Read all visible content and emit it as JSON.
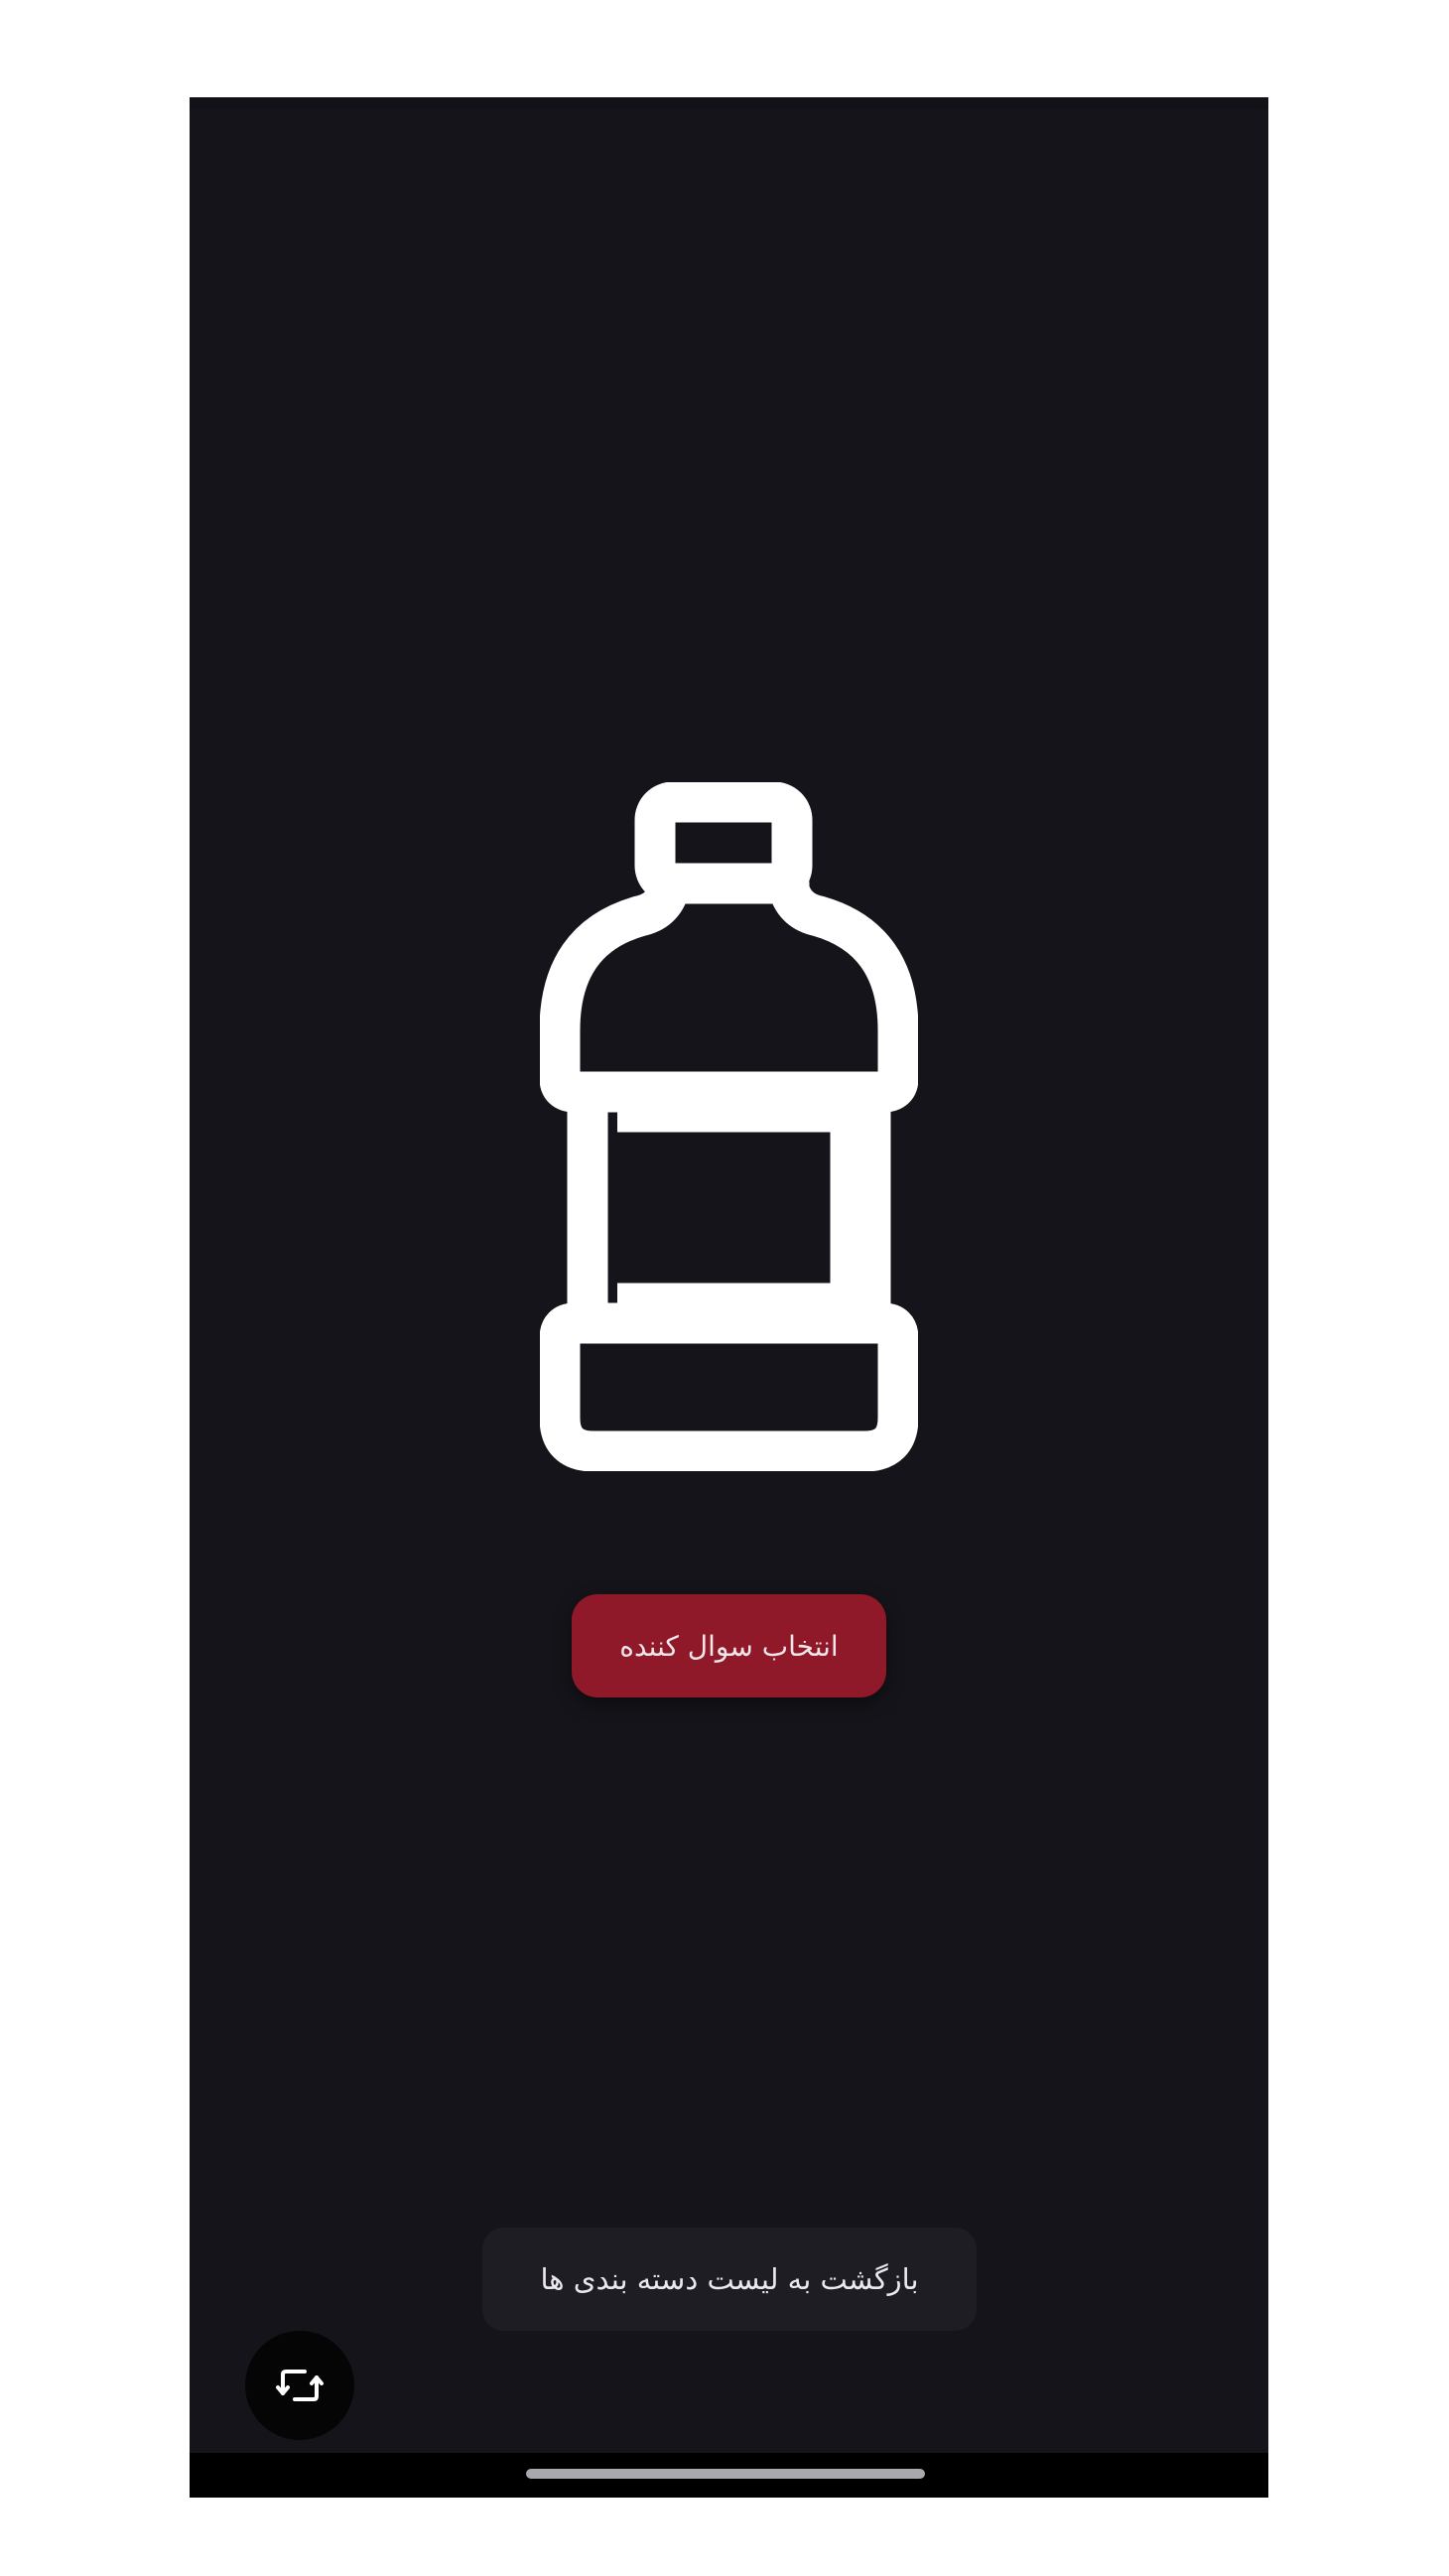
{
  "theme": {
    "background": "#15141a",
    "accent": "#8f1829",
    "icon_color": "#ffffff",
    "secondary_button": "#1e1d23"
  },
  "main": {
    "illustration_icon": "bottle-icon",
    "select_button_label": "انتخاب سوال کننده",
    "back_button_label": "بازگشت به لیست دسته بندی ها"
  },
  "fab": {
    "icon": "swap-rotate-icon"
  }
}
